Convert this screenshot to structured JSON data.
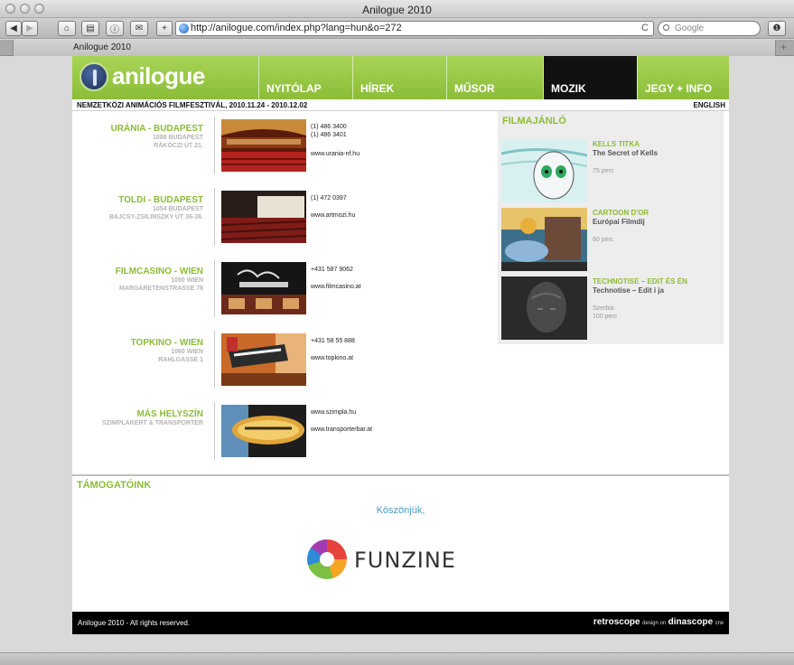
{
  "browser": {
    "window_title": "Anilogue 2010",
    "url": "http://anilogue.com/index.php?lang=hun&o=272",
    "search_placeholder": "Google",
    "search_prefix": "Q▾",
    "tab_title": "Anilogue 2010",
    "new_tab": "+",
    "reload": "C"
  },
  "site": {
    "logo": "anilogue",
    "nav": [
      {
        "label": "NYITÓLAP",
        "active": false
      },
      {
        "label": "HÍREK",
        "active": false
      },
      {
        "label": "MŰSOR",
        "active": false
      },
      {
        "label": "MOZIK",
        "active": true
      },
      {
        "label": "JEGY + INFO",
        "active": false
      }
    ],
    "subtitle": "NEMZETKÖZI ANIMÁCIÓS FILMFESZTIVÁL, 2010.11.24 - 2010.12.02",
    "lang_link": "ENGLISH"
  },
  "venues": [
    {
      "name": "URÁNIA - BUDAPEST",
      "addr1": "1088 BUDAPEST",
      "addr2": "RÁKÓCZI ÚT 21.",
      "lines": [
        "(1) 486 3400",
        "(1) 486 3401",
        "www.urania-nf.hu"
      ]
    },
    {
      "name": "TOLDI - BUDAPEST",
      "addr1": "1054 BUDAPEST",
      "addr2": "BAJCSY-ZSILINSZKY ÚT 36-38.",
      "lines": [
        "(1) 472 0397",
        "www.artmozi.hu"
      ]
    },
    {
      "name": "FILMCASINO - WIEN",
      "addr1": "1050 WIEN",
      "addr2": "MARGARETENSTRASSE 78",
      "lines": [
        "+431 587 9062",
        "www.filmcasino.at"
      ]
    },
    {
      "name": "TOPKINO - WIEN",
      "addr1": "1060 WIEN",
      "addr2": "RAHLGASSE 1",
      "lines": [
        "+431 58 55 888",
        "www.topkino.at"
      ]
    },
    {
      "name": "MÁS HELYSZÍN",
      "addr1": "SZIMPLAKERT & TRANSPORTER",
      "addr2": "",
      "lines": [
        "www.szimpla.hu",
        "www.transporterbar.at"
      ]
    }
  ],
  "recommend": {
    "title": "FILMAJÁNLÓ",
    "films": [
      {
        "title": "KELLS TITKA",
        "subtitle": "The Secret of Kells",
        "lines": [
          "75 perc"
        ]
      },
      {
        "title": "CARTOON D'OR",
        "subtitle": "Európai Filmdíj",
        "lines": [
          "80 perc"
        ]
      },
      {
        "title": "TECHNOTISE – EDIT ÉS ÉN",
        "subtitle": "Technotise – Edit i ja",
        "lines": [
          "Szerbia",
          "100 perc"
        ]
      }
    ]
  },
  "sponsors": {
    "title": "TÁMOGATÓINK",
    "thanks": "Köszönjük,",
    "sponsor_logo": "FUNZINE"
  },
  "footer": {
    "copyright": "Anilogue 2010 - All rights reserved.",
    "credit_brand1": "retroscope",
    "credit_text": "design on",
    "credit_brand2": "dinascope",
    "credit_suffix": "crw"
  },
  "colors": {
    "brand_green": "#8cbc36",
    "nav_active": "#111111",
    "link_blue": "#4a9ac8"
  }
}
